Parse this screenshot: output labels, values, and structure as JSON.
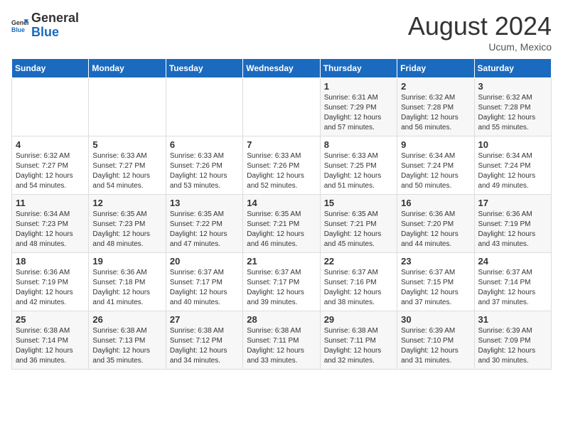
{
  "logo": {
    "general": "General",
    "blue": "Blue"
  },
  "header": {
    "month_year": "August 2024",
    "location": "Ucum, Mexico"
  },
  "days_of_week": [
    "Sunday",
    "Monday",
    "Tuesday",
    "Wednesday",
    "Thursday",
    "Friday",
    "Saturday"
  ],
  "weeks": [
    [
      {
        "day": "",
        "info": ""
      },
      {
        "day": "",
        "info": ""
      },
      {
        "day": "",
        "info": ""
      },
      {
        "day": "",
        "info": ""
      },
      {
        "day": "1",
        "info": "Sunrise: 6:31 AM\nSunset: 7:29 PM\nDaylight: 12 hours\nand 57 minutes."
      },
      {
        "day": "2",
        "info": "Sunrise: 6:32 AM\nSunset: 7:28 PM\nDaylight: 12 hours\nand 56 minutes."
      },
      {
        "day": "3",
        "info": "Sunrise: 6:32 AM\nSunset: 7:28 PM\nDaylight: 12 hours\nand 55 minutes."
      }
    ],
    [
      {
        "day": "4",
        "info": "Sunrise: 6:32 AM\nSunset: 7:27 PM\nDaylight: 12 hours\nand 54 minutes."
      },
      {
        "day": "5",
        "info": "Sunrise: 6:33 AM\nSunset: 7:27 PM\nDaylight: 12 hours\nand 54 minutes."
      },
      {
        "day": "6",
        "info": "Sunrise: 6:33 AM\nSunset: 7:26 PM\nDaylight: 12 hours\nand 53 minutes."
      },
      {
        "day": "7",
        "info": "Sunrise: 6:33 AM\nSunset: 7:26 PM\nDaylight: 12 hours\nand 52 minutes."
      },
      {
        "day": "8",
        "info": "Sunrise: 6:33 AM\nSunset: 7:25 PM\nDaylight: 12 hours\nand 51 minutes."
      },
      {
        "day": "9",
        "info": "Sunrise: 6:34 AM\nSunset: 7:24 PM\nDaylight: 12 hours\nand 50 minutes."
      },
      {
        "day": "10",
        "info": "Sunrise: 6:34 AM\nSunset: 7:24 PM\nDaylight: 12 hours\nand 49 minutes."
      }
    ],
    [
      {
        "day": "11",
        "info": "Sunrise: 6:34 AM\nSunset: 7:23 PM\nDaylight: 12 hours\nand 48 minutes."
      },
      {
        "day": "12",
        "info": "Sunrise: 6:35 AM\nSunset: 7:23 PM\nDaylight: 12 hours\nand 48 minutes."
      },
      {
        "day": "13",
        "info": "Sunrise: 6:35 AM\nSunset: 7:22 PM\nDaylight: 12 hours\nand 47 minutes."
      },
      {
        "day": "14",
        "info": "Sunrise: 6:35 AM\nSunset: 7:21 PM\nDaylight: 12 hours\nand 46 minutes."
      },
      {
        "day": "15",
        "info": "Sunrise: 6:35 AM\nSunset: 7:21 PM\nDaylight: 12 hours\nand 45 minutes."
      },
      {
        "day": "16",
        "info": "Sunrise: 6:36 AM\nSunset: 7:20 PM\nDaylight: 12 hours\nand 44 minutes."
      },
      {
        "day": "17",
        "info": "Sunrise: 6:36 AM\nSunset: 7:19 PM\nDaylight: 12 hours\nand 43 minutes."
      }
    ],
    [
      {
        "day": "18",
        "info": "Sunrise: 6:36 AM\nSunset: 7:19 PM\nDaylight: 12 hours\nand 42 minutes."
      },
      {
        "day": "19",
        "info": "Sunrise: 6:36 AM\nSunset: 7:18 PM\nDaylight: 12 hours\nand 41 minutes."
      },
      {
        "day": "20",
        "info": "Sunrise: 6:37 AM\nSunset: 7:17 PM\nDaylight: 12 hours\nand 40 minutes."
      },
      {
        "day": "21",
        "info": "Sunrise: 6:37 AM\nSunset: 7:17 PM\nDaylight: 12 hours\nand 39 minutes."
      },
      {
        "day": "22",
        "info": "Sunrise: 6:37 AM\nSunset: 7:16 PM\nDaylight: 12 hours\nand 38 minutes."
      },
      {
        "day": "23",
        "info": "Sunrise: 6:37 AM\nSunset: 7:15 PM\nDaylight: 12 hours\nand 37 minutes."
      },
      {
        "day": "24",
        "info": "Sunrise: 6:37 AM\nSunset: 7:14 PM\nDaylight: 12 hours\nand 37 minutes."
      }
    ],
    [
      {
        "day": "25",
        "info": "Sunrise: 6:38 AM\nSunset: 7:14 PM\nDaylight: 12 hours\nand 36 minutes."
      },
      {
        "day": "26",
        "info": "Sunrise: 6:38 AM\nSunset: 7:13 PM\nDaylight: 12 hours\nand 35 minutes."
      },
      {
        "day": "27",
        "info": "Sunrise: 6:38 AM\nSunset: 7:12 PM\nDaylight: 12 hours\nand 34 minutes."
      },
      {
        "day": "28",
        "info": "Sunrise: 6:38 AM\nSunset: 7:11 PM\nDaylight: 12 hours\nand 33 minutes."
      },
      {
        "day": "29",
        "info": "Sunrise: 6:38 AM\nSunset: 7:11 PM\nDaylight: 12 hours\nand 32 minutes."
      },
      {
        "day": "30",
        "info": "Sunrise: 6:39 AM\nSunset: 7:10 PM\nDaylight: 12 hours\nand 31 minutes."
      },
      {
        "day": "31",
        "info": "Sunrise: 6:39 AM\nSunset: 7:09 PM\nDaylight: 12 hours\nand 30 minutes."
      }
    ]
  ]
}
